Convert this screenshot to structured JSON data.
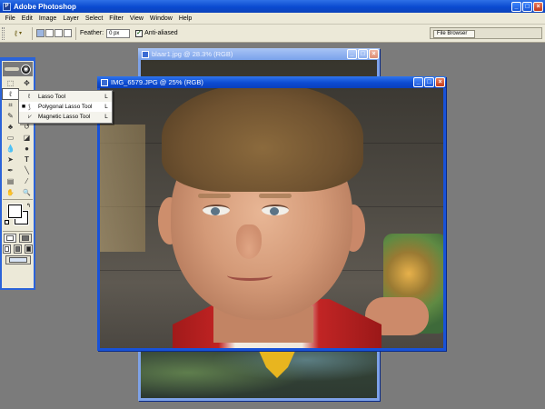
{
  "app": {
    "title": "Adobe Photoshop",
    "icon": "ps-app-icon",
    "window_buttons": {
      "minimize": "_",
      "maximize": "□",
      "close": "×"
    }
  },
  "menu": {
    "items": [
      "File",
      "Edit",
      "Image",
      "Layer",
      "Select",
      "Filter",
      "View",
      "Window",
      "Help"
    ]
  },
  "options_bar": {
    "tool_icon": "lasso-icon",
    "tool_dropdown": "▾",
    "feather_label": "Feather:",
    "feather_value": "0 px",
    "antialias_label": "Anti-aliased",
    "antialias_checked": true,
    "file_browser_tab": "File Browser"
  },
  "flyout": {
    "items": [
      {
        "label": "Lasso Tool",
        "shortcut": "L",
        "selected": false
      },
      {
        "label": "Polygonal Lasso Tool",
        "shortcut": "L",
        "selected": true
      },
      {
        "label": "Magnetic Lasso Tool",
        "shortcut": "L",
        "selected": false
      }
    ]
  },
  "toolbox": {
    "tools": [
      {
        "name": "marquee-icon",
        "glyph": "⬚"
      },
      {
        "name": "move-icon",
        "glyph": "✥"
      },
      {
        "name": "lasso-icon",
        "glyph": "ℓ",
        "active": true
      },
      {
        "name": "magic-wand-icon",
        "glyph": "✦"
      },
      {
        "name": "crop-icon",
        "glyph": "⌗"
      },
      {
        "name": "slice-icon",
        "glyph": "⟋"
      },
      {
        "name": "healing-brush-icon",
        "glyph": "✎"
      },
      {
        "name": "brush-icon",
        "glyph": "✐"
      },
      {
        "name": "clone-stamp-icon",
        "glyph": "♣"
      },
      {
        "name": "history-brush-icon",
        "glyph": "↺"
      },
      {
        "name": "eraser-icon",
        "glyph": "▭"
      },
      {
        "name": "gradient-icon",
        "glyph": "◪"
      },
      {
        "name": "blur-icon",
        "glyph": "💧"
      },
      {
        "name": "dodge-icon",
        "glyph": "●"
      },
      {
        "name": "path-selection-icon",
        "glyph": "➤"
      },
      {
        "name": "type-icon",
        "glyph": "T"
      },
      {
        "name": "pen-icon",
        "glyph": "✒"
      },
      {
        "name": "line-icon",
        "glyph": "╲"
      },
      {
        "name": "notes-icon",
        "glyph": "▤"
      },
      {
        "name": "eyedropper-icon",
        "glyph": "⁄"
      },
      {
        "name": "hand-icon",
        "glyph": "✋"
      },
      {
        "name": "zoom-icon",
        "glyph": "🔍"
      }
    ],
    "foreground_color": "#ffffff",
    "background_color": "#ffffff"
  },
  "documents": {
    "back": {
      "title": "blaar1.jpg @ 28.3% (RGB)"
    },
    "front": {
      "title": "IMG_6579.JPG @ 25% (RGB)"
    }
  },
  "colors": {
    "xp_blue": "#0a4ad0",
    "workspace": "#7b7b7b",
    "chrome": "#ece9d8"
  }
}
